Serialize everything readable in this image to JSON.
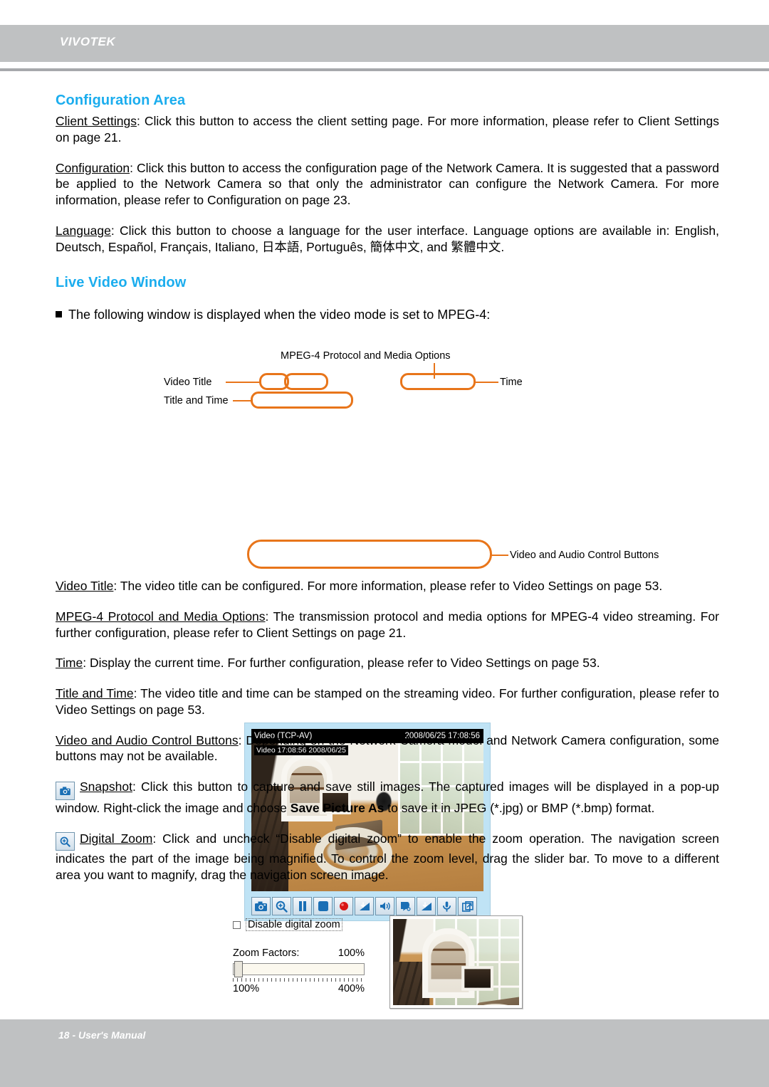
{
  "header": {
    "brand": "VIVOTEK"
  },
  "footer": {
    "text": "18 - User's Manual"
  },
  "sections": {
    "configuration_area": {
      "heading": "Configuration Area",
      "paragraphs": [
        {
          "term": "Client Settings",
          "body": ": Click this button to access the client setting page. For more information, please refer to Client Settings on page 21."
        },
        {
          "term": "Configuration",
          "body": ": Click this button to access the configuration page of the Network Camera. It is suggested that a password be applied to the Network Camera so that only the administrator can configure the Network Camera. For more information, please refer to Configuration on page 23."
        },
        {
          "term": "Language",
          "body": ": Click this button to choose a language for the user interface. Language options are available in: English, Deutsch, Español, Français, Italiano, 日本語, Português, 簡体中文, and 繁體中文."
        }
      ]
    },
    "live_video_window": {
      "heading": "Live Video Window",
      "bullet": "The following window is displayed when the video mode is set to MPEG-4:",
      "paragraphs": [
        {
          "term": "Video Title",
          "body": ": The video title can be configured. For more information, please refer to Video Settings on page 53."
        },
        {
          "term": "MPEG-4 Protocol and Media Options",
          "body": ": The transmission protocol and media options for MPEG-4 video streaming. For further configuration, please refer to Client Settings on page 21."
        },
        {
          "term": "Time",
          "body": ": Display the current time. For further configuration, please refer to Video Settings on page 53."
        },
        {
          "term": "Title and Time",
          "body": ": The video title and time can be stamped on the streaming video. For further configuration, please refer to Video Settings on page 53."
        },
        {
          "term": "Video and Audio Control Buttons",
          "body": ": Depending on the Network Camera model and Network Camera configuration, some buttons may not be available."
        }
      ],
      "snapshot": {
        "term": "Snapshot",
        "body_1": ": Click this button to capture and save still images. The captured images will be displayed in a pop-up window. Right-click the image and choose ",
        "bold": "Save Picture As",
        "body_2": " to save it in JPEG (*.jpg) or BMP (*.bmp) format."
      },
      "digital_zoom": {
        "term": "Digital Zoom",
        "body": ": Click and uncheck “Disable digital zoom” to enable the zoom operation. The navigation screen indicates the part of the image being magnified. To control the zoom level, drag the slider bar. To move to a different area you want to magnify, drag the navigation screen image."
      }
    }
  },
  "figure_live_window": {
    "callouts": {
      "top": "MPEG-4 Protocol and Media Options",
      "video_title": "Video Title",
      "title_and_time": "Title and Time",
      "time": "Time",
      "controls": "Video and Audio Control Buttons"
    },
    "video_window": {
      "title_left": "Video (TCP-AV)",
      "title_right": "2008/06/25 17:08:56",
      "overlay_stamp": "Video 17:08:56  2008/06/25"
    },
    "buttons": [
      {
        "name": "snapshot-icon",
        "label": "Snapshot"
      },
      {
        "name": "digital-zoom-icon",
        "label": "Digital Zoom"
      },
      {
        "name": "pause-icon",
        "label": "Pause"
      },
      {
        "name": "stop-icon",
        "label": "Stop"
      },
      {
        "name": "record-icon",
        "label": "Start MP4 Recording"
      },
      {
        "name": "volume-down-icon",
        "label": "Volume"
      },
      {
        "name": "speaker-icon",
        "label": "Mute"
      },
      {
        "name": "talk-icon",
        "label": "Talk"
      },
      {
        "name": "mic-level-icon",
        "label": "Mic Volume"
      },
      {
        "name": "microphone-icon",
        "label": "Mute Mic"
      },
      {
        "name": "fullscreen-icon",
        "label": "Full Screen"
      }
    ]
  },
  "figure_zoom_dialog": {
    "checkbox_label": "Disable digital zoom",
    "checkbox_checked": false,
    "zoom_factors_label": "Zoom Factors:",
    "zoom_factors_value": "100%",
    "slider_min": "100%",
    "slider_max": "400%",
    "slider_position_percent": 0
  },
  "colors": {
    "heading_blue": "#1badee",
    "header_gray": "#bfc1c2",
    "callout_orange": "#e8751a",
    "window_blue": "#bfe3f5"
  }
}
